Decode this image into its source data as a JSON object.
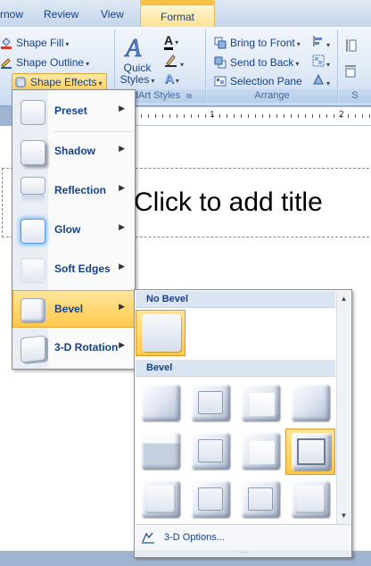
{
  "tabs": {
    "view_prev": "rnow",
    "review": "Review",
    "view": "View",
    "format": "Format"
  },
  "ribbon": {
    "shape_fill": "Shape Fill",
    "shape_outline": "Shape Outline",
    "shape_effects": "Shape Effects",
    "quick_styles_line1": "Quick",
    "quick_styles_line2": "Styles",
    "wordart_group_label": "rdArt Styles",
    "bring_to_front": "Bring to Front",
    "send_to_back": "Send to Back",
    "selection_pane": "Selection Pane",
    "arrange_group_label": "Arrange",
    "size_group_label": "S"
  },
  "ruler": {
    "labels": [
      "1",
      "2"
    ]
  },
  "slide": {
    "title_placeholder": "Click to add title"
  },
  "shape_effects_menu": {
    "items": [
      {
        "label": "Preset"
      },
      {
        "label": "Shadow"
      },
      {
        "label": "Reflection"
      },
      {
        "label": "Glow"
      },
      {
        "label": "Soft Edges"
      },
      {
        "label": "Bevel"
      },
      {
        "label": "3-D Rotation"
      }
    ],
    "active_item": "Bevel"
  },
  "bevel_gallery": {
    "no_bevel_heading": "No Bevel",
    "bevel_heading": "Bevel",
    "options_link": "3-D Options...",
    "selected_index": 7
  },
  "colors": {
    "accent_highlight": "#ffc94a",
    "ribbon_text": "#15428b"
  }
}
